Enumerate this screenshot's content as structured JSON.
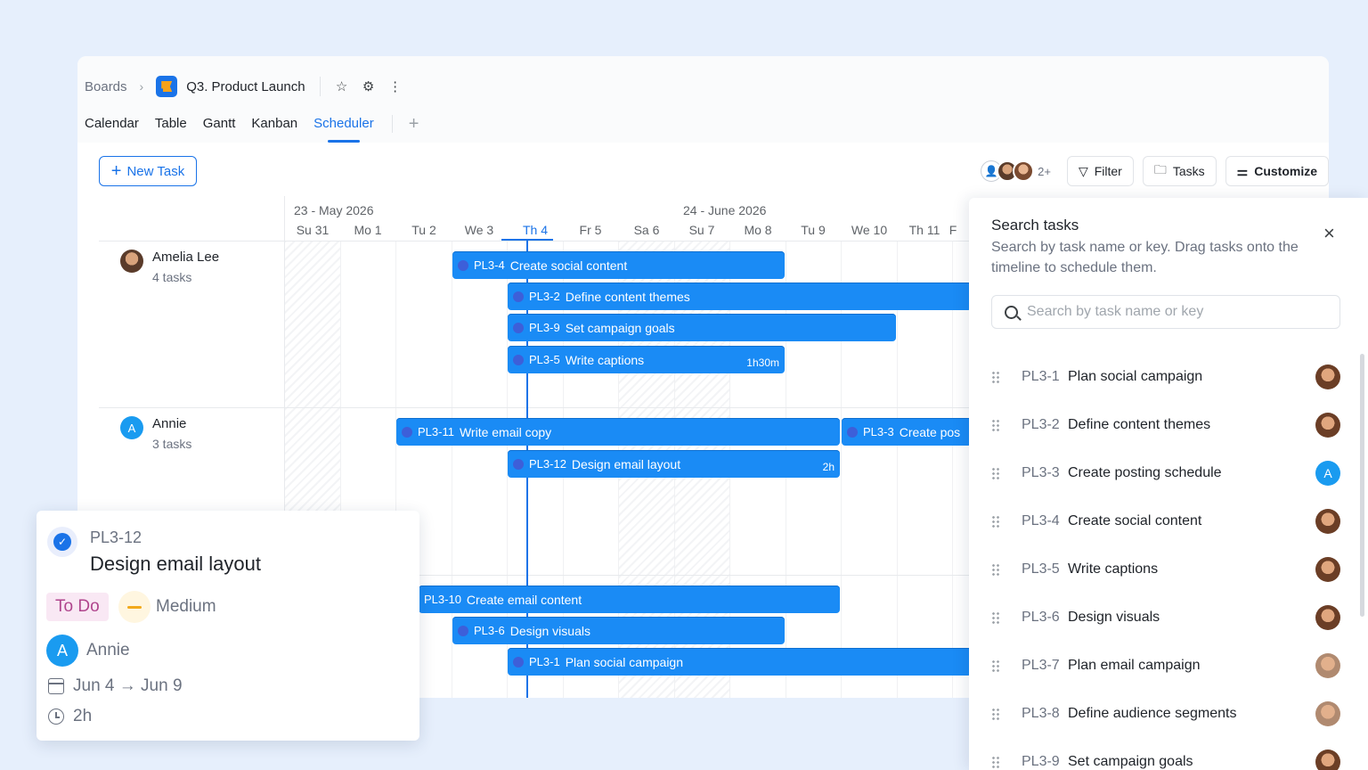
{
  "breadcrumb": {
    "root": "Boards",
    "project": "Q3. Product Launch"
  },
  "tabs": [
    {
      "label": "Calendar",
      "active": false
    },
    {
      "label": "Table",
      "active": false
    },
    {
      "label": "Gantt",
      "active": false
    },
    {
      "label": "Kanban",
      "active": false
    },
    {
      "label": "Scheduler",
      "active": true
    }
  ],
  "toolbar": {
    "new_task": "New Task",
    "avatar_more": "2+",
    "filter": "Filter",
    "tasks": "Tasks",
    "customize": "Customize"
  },
  "timeline": {
    "months": [
      "23 - May 2026",
      "24 - June 2026"
    ],
    "days": [
      "Su 31",
      "Mo 1",
      "Tu 2",
      "We 3",
      "Th 4",
      "Fr 5",
      "Sa 6",
      "Su 7",
      "Mo 8",
      "Tu 9",
      "We 10",
      "Th 11",
      "F"
    ],
    "today": "Th 4",
    "people": [
      {
        "name": "Amelia Lee",
        "count": "4 tasks",
        "avatar": "photo"
      },
      {
        "name": "Annie",
        "count": "3 tasks",
        "avatar": "A"
      }
    ],
    "bars": [
      {
        "key": "PL3-4",
        "name": "Create social content",
        "duration": ""
      },
      {
        "key": "PL3-2",
        "name": "Define content themes",
        "duration": ""
      },
      {
        "key": "PL3-9",
        "name": "Set campaign goals",
        "duration": ""
      },
      {
        "key": "PL3-5",
        "name": "Write captions",
        "duration": "1h30m"
      },
      {
        "key": "PL3-11",
        "name": "Write email copy",
        "duration": ""
      },
      {
        "key": "PL3-3",
        "name": "Create pos",
        "duration": ""
      },
      {
        "key": "PL3-12",
        "name": "Design email layout",
        "duration": "2h"
      },
      {
        "key": "PL3-10",
        "name": "Create email content",
        "duration": ""
      },
      {
        "key": "PL3-6",
        "name": "Design visuals",
        "duration": ""
      },
      {
        "key": "PL3-1",
        "name": "Plan social campaign",
        "duration": ""
      }
    ]
  },
  "card": {
    "key": "PL3-12",
    "title": "Design email layout",
    "status": "To Do",
    "priority": "Medium",
    "assignee_initial": "A",
    "assignee": "Annie",
    "dates": "Jun 4 → Jun 9",
    "estimate": "2h"
  },
  "panel": {
    "title": "Search tasks",
    "description": "Search by task name or key. Drag tasks onto the timeline to schedule them.",
    "search_placeholder": "Search by task name or key",
    "items": [
      {
        "key": "PL3-1",
        "name": "Plan social campaign",
        "avatar": "photoA"
      },
      {
        "key": "PL3-2",
        "name": "Define content themes",
        "avatar": "photoA"
      },
      {
        "key": "PL3-3",
        "name": "Create posting schedule",
        "avatar": "A"
      },
      {
        "key": "PL3-4",
        "name": "Create social content",
        "avatar": "photoA"
      },
      {
        "key": "PL3-5",
        "name": "Write captions",
        "avatar": "photoA"
      },
      {
        "key": "PL3-6",
        "name": "Design visuals",
        "avatar": "photoA"
      },
      {
        "key": "PL3-7",
        "name": "Plan email campaign",
        "avatar": "photoB"
      },
      {
        "key": "PL3-8",
        "name": "Define audience segments",
        "avatar": "photoB"
      },
      {
        "key": "PL3-9",
        "name": "Set campaign goals",
        "avatar": "photoA"
      }
    ]
  },
  "colors": {
    "accent": "#1a73e8",
    "bar": "#1a8bf5",
    "status_todo_bg": "#f9e8f4",
    "status_todo_text": "#b0458d",
    "priority": "#f2a91b"
  }
}
